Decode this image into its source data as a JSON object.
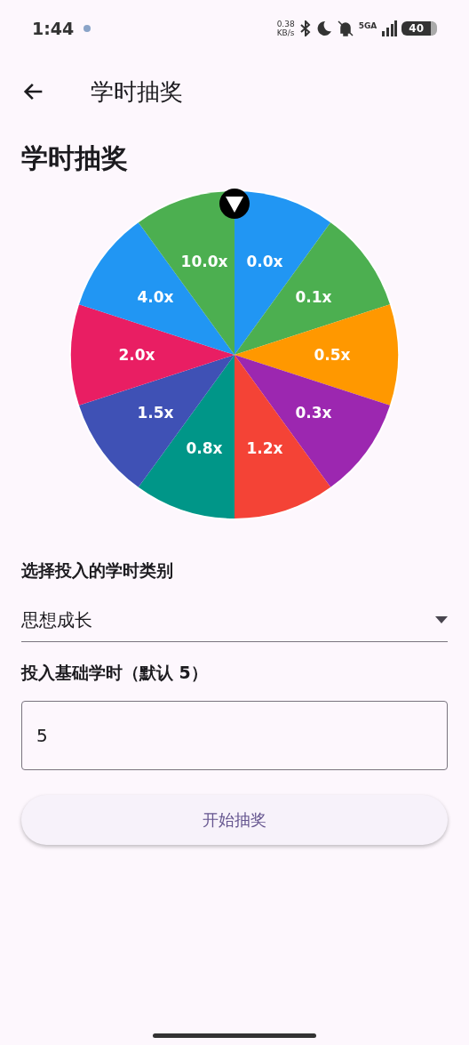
{
  "status_bar": {
    "time": "1:44",
    "net_speed": "0.38",
    "net_unit": "KB/s",
    "network": "5GA",
    "battery": "40"
  },
  "app_bar": {
    "title": "学时抽奖"
  },
  "heading": "学时抽奖",
  "wheel": {
    "segments": [
      {
        "label": "0.0x",
        "color": "#2196f3"
      },
      {
        "label": "0.1x",
        "color": "#4caf50"
      },
      {
        "label": "0.5x",
        "color": "#ff9800"
      },
      {
        "label": "0.3x",
        "color": "#9c27b0"
      },
      {
        "label": "1.2x",
        "color": "#f44336"
      },
      {
        "label": "0.8x",
        "color": "#009688"
      },
      {
        "label": "1.5x",
        "color": "#3f51b5"
      },
      {
        "label": "2.0x",
        "color": "#e91e63"
      },
      {
        "label": "4.0x",
        "color": "#2196f3"
      },
      {
        "label": "10.0x",
        "color": "#4caf50"
      }
    ]
  },
  "category_label": "选择投入的学时类别",
  "category_select": {
    "value": "思想成长"
  },
  "hours_label": "投入基础学时（默认 5）",
  "hours_field": {
    "value": "5"
  },
  "start_button": "开始抽奖"
}
